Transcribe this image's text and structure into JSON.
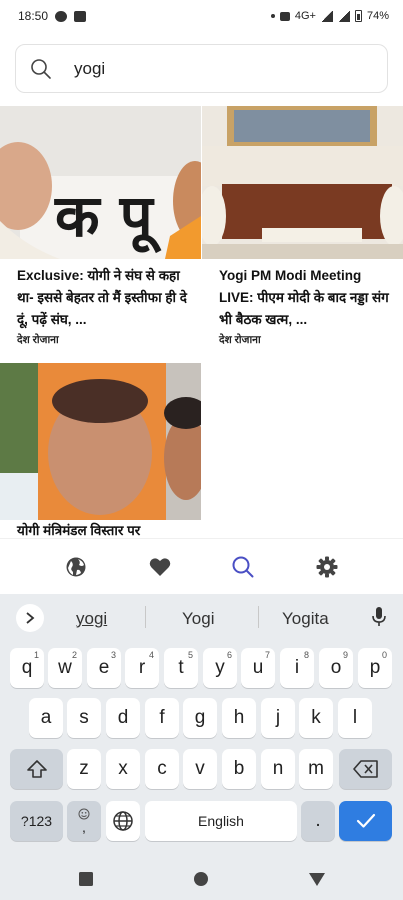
{
  "status": {
    "time": "18:50",
    "network": "4G+",
    "battery": "74%"
  },
  "search": {
    "query": "yogi",
    "placeholder": ""
  },
  "results": [
    {
      "title": "Exclusive: योगी ने संघ से कहा था- इससे बेहतर तो मैं इस्तीफा ही दे दूं, पढ़ें संघ, ...",
      "source": "देश रोजाना",
      "image_text": "क पू"
    },
    {
      "title": "Yogi PM Modi Meeting LIVE: पीएम मोदी के बाद नड्डा संग भी बैठक खत्म, ...",
      "source": "देश रोजाना"
    },
    {
      "title": "योगी मंत्रिमंडल विस्तार पर",
      "source": ""
    }
  ],
  "app_nav": {
    "items": [
      "globe-icon",
      "heart-icon",
      "search-icon",
      "gear-icon"
    ],
    "active_color": "#4a4fc4"
  },
  "keyboard": {
    "suggestions": [
      "yogi",
      "Yogi",
      "Yogita"
    ],
    "row1": [
      "q",
      "w",
      "e",
      "r",
      "t",
      "y",
      "u",
      "i",
      "o",
      "p"
    ],
    "row1_hints": [
      "1",
      "2",
      "3",
      "4",
      "5",
      "6",
      "7",
      "8",
      "9",
      "0"
    ],
    "row2": [
      "a",
      "s",
      "d",
      "f",
      "g",
      "h",
      "j",
      "k",
      "l"
    ],
    "row3": [
      "z",
      "x",
      "c",
      "v",
      "b",
      "n",
      "m"
    ],
    "symbols_label": "?123",
    "emoji_comma": ",",
    "space_label": "English",
    "period_label": ".",
    "accent_color": "#2f7de1"
  }
}
